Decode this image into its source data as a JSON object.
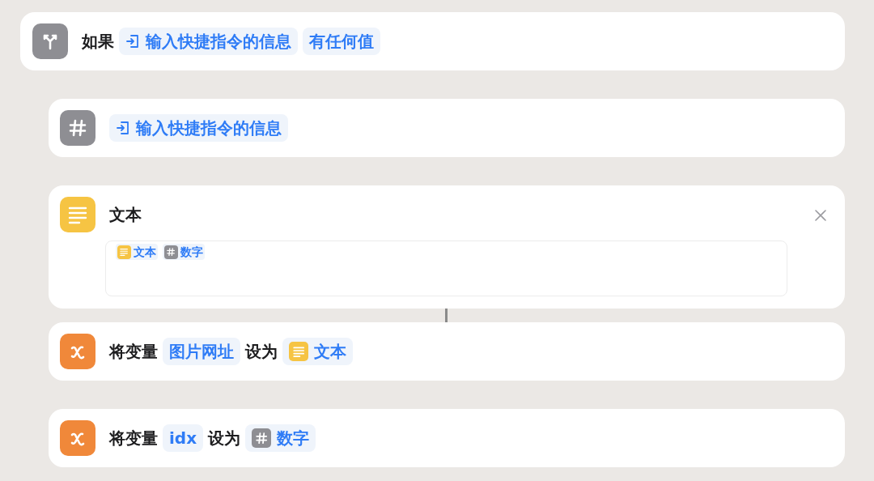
{
  "blocks": [
    {
      "kind": "if",
      "parts": [
        {
          "kind": "label",
          "text": "如果"
        },
        {
          "kind": "input_token",
          "text": "输入快捷指令的信息"
        },
        {
          "kind": "token",
          "text": "有任何值"
        }
      ],
      "children": [
        {
          "kind": "number",
          "parts": [
            {
              "kind": "input_token",
              "text": "输入快捷指令的信息"
            }
          ]
        },
        {
          "kind": "text",
          "title": "文本",
          "field": [
            {
              "kind": "text_token",
              "text": "文本"
            },
            {
              "kind": "number_token",
              "text": "数字"
            }
          ]
        },
        {
          "kind": "variable",
          "parts": [
            {
              "kind": "label",
              "text": "将变量"
            },
            {
              "kind": "token",
              "text": "图片网址"
            },
            {
              "kind": "label",
              "text": "设为"
            },
            {
              "kind": "text_token",
              "text": "文本"
            }
          ]
        },
        {
          "kind": "variable",
          "parts": [
            {
              "kind": "label",
              "text": "将变量"
            },
            {
              "kind": "token",
              "text": "idx"
            },
            {
              "kind": "label",
              "text": "设为"
            },
            {
              "kind": "number_token",
              "text": "数字"
            }
          ]
        }
      ]
    }
  ]
}
